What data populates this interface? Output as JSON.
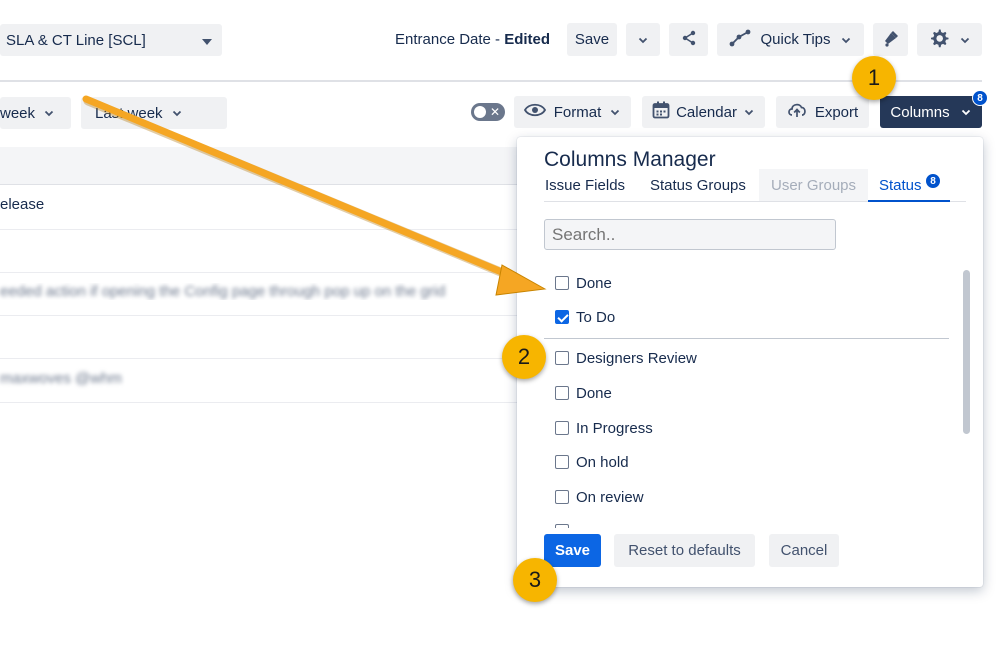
{
  "topbar": {
    "project_select": "SLA & CT Line [SCL]",
    "view_label_prefix": "Entrance Date - ",
    "view_label_state": "Edited",
    "save_label": "Save",
    "quick_tips_label": "Quick Tips"
  },
  "toolbar": {
    "week_label": "week",
    "last_week_label": "Last week",
    "format_label": "Format",
    "calendar_label": "Calendar",
    "export_label": "Export",
    "columns_label": "Columns",
    "columns_count": "8"
  },
  "grid": {
    "rows": [
      "elease",
      "eeded action if opening the Config page through pop up on the grid",
      "maxwoves @whm"
    ]
  },
  "columns_manager": {
    "title": "Columns Manager",
    "tabs": [
      {
        "label": "Issue Fields",
        "state": "normal"
      },
      {
        "label": "Status Groups",
        "state": "normal"
      },
      {
        "label": "User Groups",
        "state": "disabled"
      },
      {
        "label": "Status",
        "state": "active",
        "badge": "8"
      }
    ],
    "search_placeholder": "Search..",
    "selected_group": [
      {
        "label": "Done",
        "checked": false
      },
      {
        "label": "To Do",
        "checked": true
      }
    ],
    "available_group": [
      {
        "label": "Designers Review",
        "checked": false
      },
      {
        "label": "Done",
        "checked": false
      },
      {
        "label": "In Progress",
        "checked": false
      },
      {
        "label": "On hold",
        "checked": false
      },
      {
        "label": "On review",
        "checked": false
      }
    ],
    "save_label": "Save",
    "reset_label": "Reset to defaults",
    "cancel_label": "Cancel"
  },
  "callouts": [
    "1",
    "2",
    "3"
  ],
  "colors": {
    "accent_blue": "#0c66e4",
    "dark_button": "#253858",
    "callout": "#f7b500",
    "arrow": "#f5a623"
  }
}
